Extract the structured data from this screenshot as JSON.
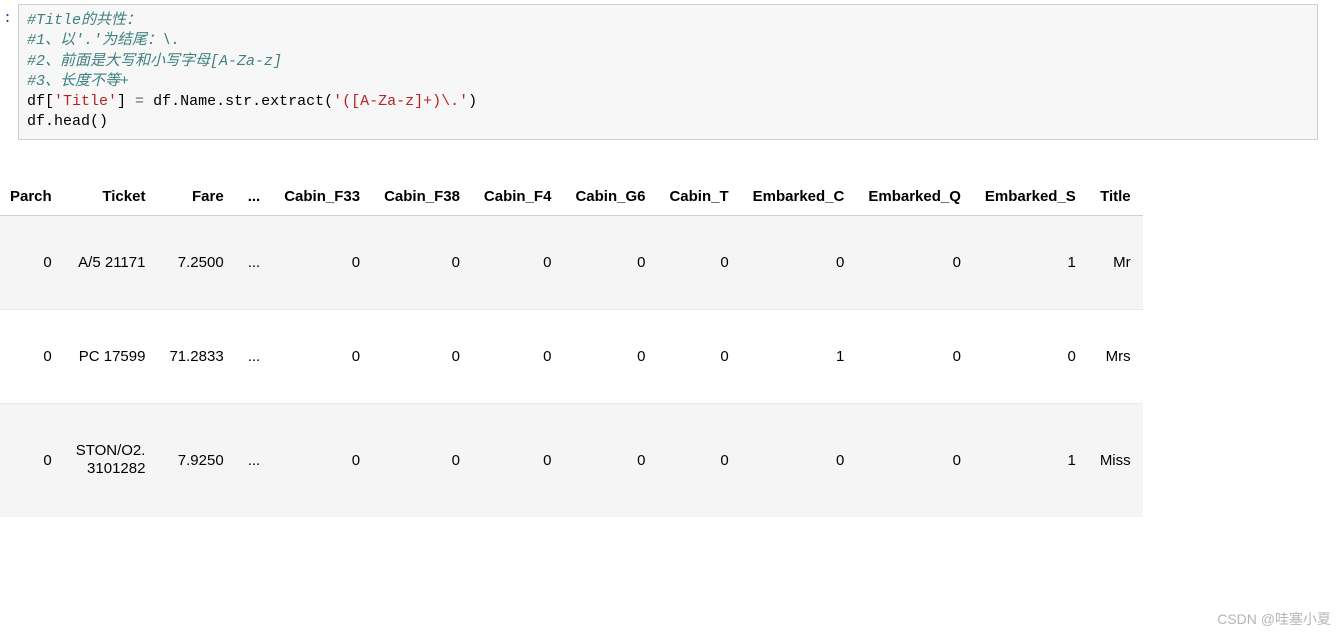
{
  "prompt": ":",
  "code": {
    "c1": "#Title的共性：",
    "c2": "#1、以'.'为结尾：\\.",
    "c3": "#2、前面是大写和小写字母[A-Za-z]",
    "c4": "#3、长度不等+",
    "l5_a": "df[",
    "l5_str": "'Title'",
    "l5_b": "] ",
    "l5_eq": "=",
    "l5_c": " df.Name.str.extract(",
    "l5_regex": "'([A-Za-z]+)\\.'",
    "l5_d": ")",
    "l6": "df.head()"
  },
  "headers": [
    "Parch",
    "Ticket",
    "Fare",
    "...",
    "Cabin_F33",
    "Cabin_F38",
    "Cabin_F4",
    "Cabin_G6",
    "Cabin_T",
    "Embarked_C",
    "Embarked_Q",
    "Embarked_S",
    "Title"
  ],
  "rows": [
    {
      "Parch": "0",
      "Ticket": "A/5 21171",
      "Fare": "7.2500",
      "dots": "...",
      "Cabin_F33": "0",
      "Cabin_F38": "0",
      "Cabin_F4": "0",
      "Cabin_G6": "0",
      "Cabin_T": "0",
      "Embarked_C": "0",
      "Embarked_Q": "0",
      "Embarked_S": "1",
      "Title": "Mr"
    },
    {
      "Parch": "0",
      "Ticket": "PC 17599",
      "Fare": "71.2833",
      "dots": "...",
      "Cabin_F33": "0",
      "Cabin_F38": "0",
      "Cabin_F4": "0",
      "Cabin_G6": "0",
      "Cabin_T": "0",
      "Embarked_C": "1",
      "Embarked_Q": "0",
      "Embarked_S": "0",
      "Title": "Mrs"
    },
    {
      "Parch": "0",
      "Ticket": "STON/O2.\n3101282",
      "Fare": "7.9250",
      "dots": "...",
      "Cabin_F33": "0",
      "Cabin_F38": "0",
      "Cabin_F4": "0",
      "Cabin_G6": "0",
      "Cabin_T": "0",
      "Embarked_C": "0",
      "Embarked_Q": "0",
      "Embarked_S": "1",
      "Title": "Miss"
    }
  ],
  "watermark": "CSDN @哇塞小夏"
}
